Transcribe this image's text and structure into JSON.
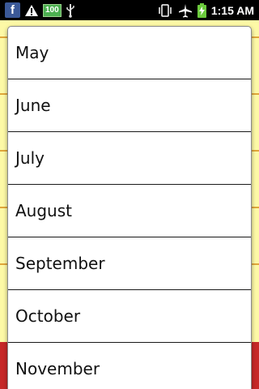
{
  "status_bar": {
    "icons": [
      "facebook-icon",
      "warning-icon",
      "battery-100-icon",
      "usb-icon",
      "vibrate-icon",
      "airplane-icon",
      "battery-charging-icon"
    ],
    "battery_level": "100",
    "time": "1:15 AM"
  },
  "dropdown": {
    "options": [
      "May",
      "June",
      "July",
      "August",
      "September",
      "October",
      "November"
    ]
  },
  "colors": {
    "app_background": "#fdf9a6",
    "app_accent": "#c62828",
    "facebook_blue": "#3b5998",
    "battery_green": "#4caf50"
  }
}
